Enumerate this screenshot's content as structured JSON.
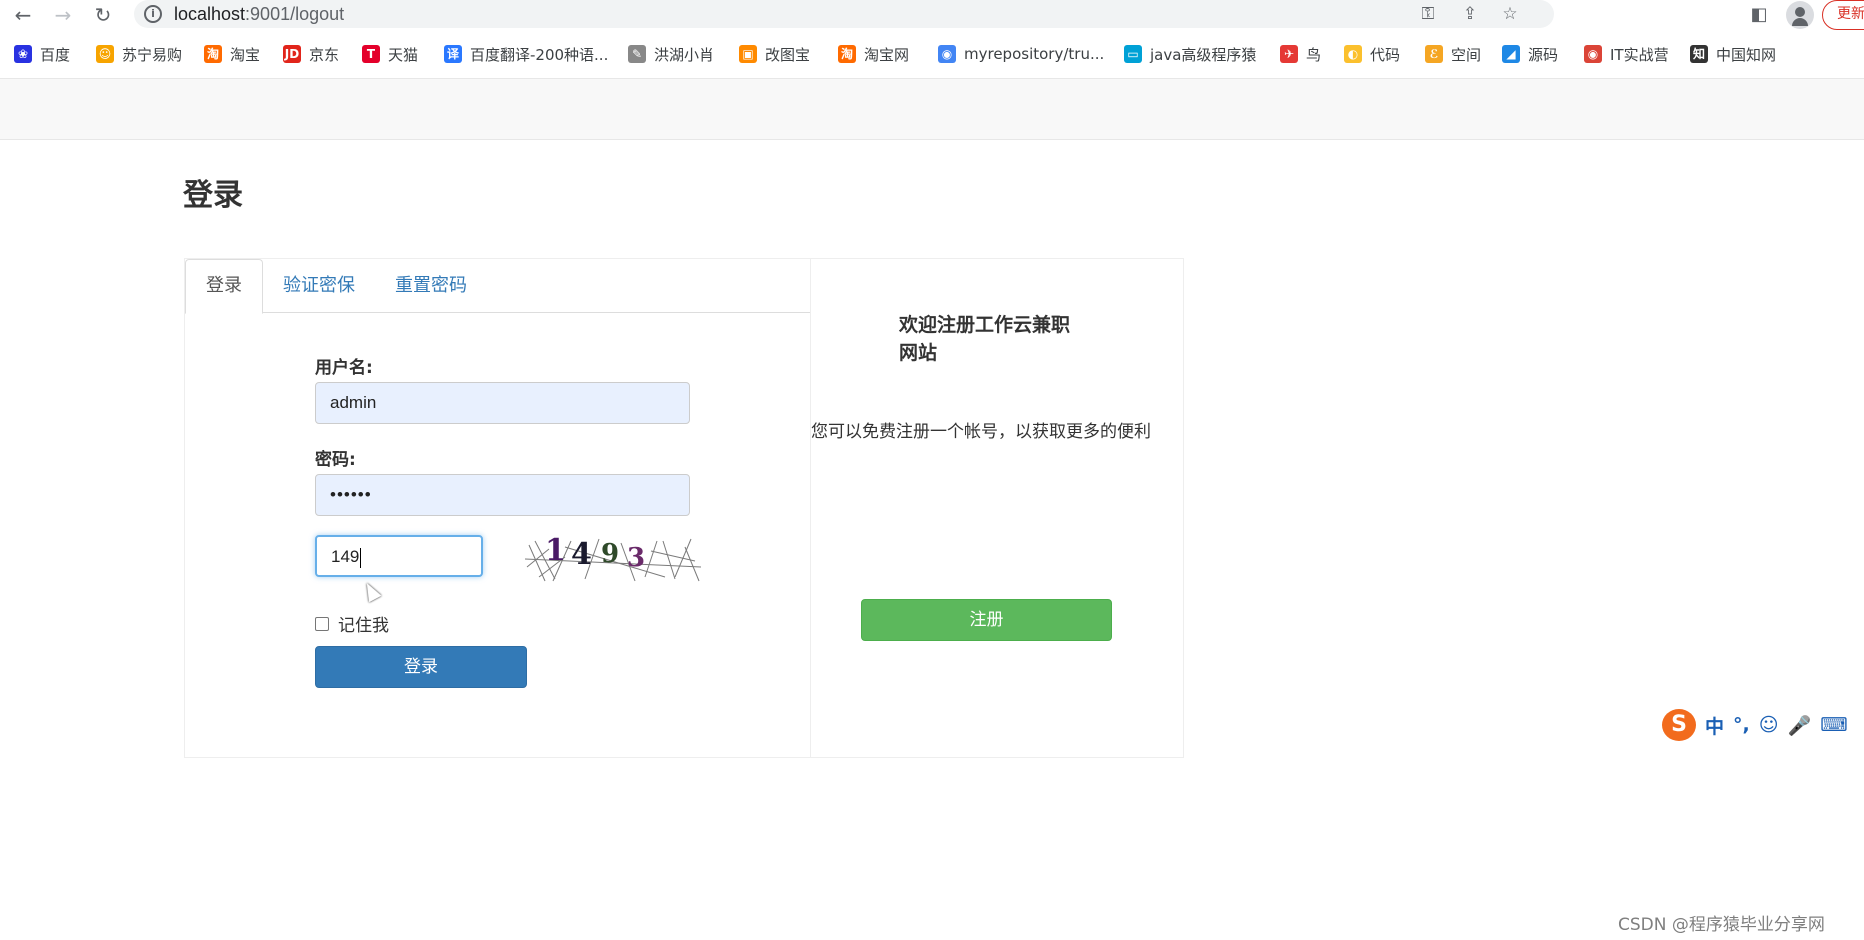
{
  "browser": {
    "url_host": "localhost",
    "url_path": ":9001/logout",
    "update_label": "更新",
    "bookmarks": [
      {
        "label": "百度",
        "icon": "baidu-icon",
        "color": "#2932e1"
      },
      {
        "label": "苏宁易购",
        "icon": "suning-icon",
        "color": "#f7a400"
      },
      {
        "label": "淘宝",
        "icon": "taobao-icon",
        "color": "#ff6a00"
      },
      {
        "label": "京东",
        "icon": "jd-icon",
        "color": "#e1251b"
      },
      {
        "label": "天猫",
        "icon": "tmall-icon",
        "color": "#e4002b"
      },
      {
        "label": "百度翻译-200种语...",
        "icon": "baidu-translate-icon",
        "color": "#2a78ff"
      },
      {
        "label": "洪湖小肖",
        "icon": "bird-icon",
        "color": "#888888"
      },
      {
        "label": "改图宝",
        "icon": "gaitubao-icon",
        "color": "#ff8a00"
      },
      {
        "label": "淘宝网",
        "icon": "taobao-icon",
        "color": "#ff6a00"
      },
      {
        "label": "myrepository/tru...",
        "icon": "chrome-icon",
        "color": "#4285f4"
      },
      {
        "label": "java高级程序猿",
        "icon": "bilibili-icon",
        "color": "#00a1d6"
      },
      {
        "label": "鸟",
        "icon": "bird-icon",
        "color": "#e53935"
      },
      {
        "label": "代码",
        "icon": "code-icon",
        "color": "#fbc02d"
      },
      {
        "label": "空间",
        "icon": "qzone-icon",
        "color": "#f5a623"
      },
      {
        "label": "源码",
        "icon": "source-icon",
        "color": "#1e88e5"
      },
      {
        "label": "IT实战营",
        "icon": "chrome-icon",
        "color": "#db4437"
      },
      {
        "label": "中国知网",
        "icon": "cnki-icon",
        "color": "#333333"
      }
    ]
  },
  "page": {
    "title": "登录",
    "tabs": [
      {
        "label": "登录",
        "active": true
      },
      {
        "label": "验证密保",
        "active": false
      },
      {
        "label": "重置密码",
        "active": false
      }
    ],
    "form": {
      "username_label": "用户名:",
      "username_value": "admin",
      "password_label": "密码:",
      "password_value": "••••••",
      "captcha_value": "149",
      "captcha_digits": [
        "1",
        "4",
        "9",
        "3"
      ],
      "remember_label": "记住我",
      "remember_checked": false,
      "submit_label": "登录"
    },
    "side": {
      "welcome_line1": "欢迎注册工作云兼职",
      "welcome_line2": "网站",
      "promo": "您可以免费注册一个帐号，以获取更多的便利",
      "register_label": "注册"
    }
  },
  "ime": {
    "items": [
      "中",
      "°,",
      "☺",
      "🎤",
      "⌨"
    ]
  },
  "watermark": "CSDN @程序猿毕业分享网",
  "colors": {
    "primary": "#337ab7",
    "success": "#5cb85c",
    "navbar": "#f8f8f8"
  }
}
